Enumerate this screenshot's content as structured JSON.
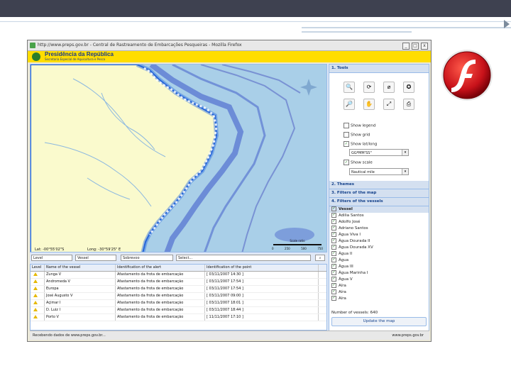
{
  "window": {
    "title": "http://www.preps.gov.br - Central de Rastreamento de Embarcações Pesqueiras - Mozilla Firefox",
    "controls": [
      "_",
      "□",
      "x"
    ]
  },
  "banner": {
    "title": "Presidência da República",
    "subtitle": "Secretaria Especial de Aquicultura e Pesca"
  },
  "map": {
    "lat_label": "Lat: -00°55'02\"S",
    "long_label": "Long: -30°59'25\" E",
    "scale_label": "Scale ratio",
    "scale_ticks": [
      "0",
      "250",
      "500",
      "750"
    ]
  },
  "tools": {
    "header": "1. Tools",
    "checks": [
      {
        "label": "Show legend",
        "checked": false
      },
      {
        "label": "Show grid",
        "checked": false
      },
      {
        "label": "Show lat/long",
        "checked": true
      },
      {
        "label": "Show scale",
        "checked": true
      }
    ],
    "latlong_select": "GGºMM'SS\"",
    "scale_select": "Nautical mile"
  },
  "sections": {
    "themes": "2. Themes",
    "map_filters": "3. Filters of the map",
    "vessel_filters": "4. Filters of the vessels"
  },
  "vessels": {
    "header": "Vessel",
    "items": [
      "Adilia Santos",
      "Adolfo José",
      "Adriano Santos",
      "Água Viva I",
      "Água Dourada II",
      "Água Dourada XV",
      "Água II",
      "Água",
      "Água III",
      "Água Marinha I",
      "Água V",
      "Aíra",
      "Aíra",
      "Aíra"
    ],
    "count_label": "Number of vessels: 640",
    "update_button": "Update the map"
  },
  "filters": {
    "level": "Level",
    "vessel": "Vessel",
    "alert": "Sobrevoo",
    "select": "Select..."
  },
  "alerts_table": {
    "columns": [
      "Level",
      "Name of the vessel",
      "Identification of the alert",
      "Identification of the point"
    ],
    "rows": [
      {
        "vessel": "Zunga V",
        "alert": "Afastamento da frota de embarcação",
        "point": "[ 03/11/2007 14:30 ]"
      },
      {
        "vessel": "Andromeda V",
        "alert": "Afastamento da frota de embarcação",
        "point": "[ 03/11/2007 17:54 ]"
      },
      {
        "vessel": "Europa",
        "alert": "Afastamento da frota de embarcação",
        "point": "[ 03/11/2007 17:54 ]"
      },
      {
        "vessel": "José Augusto V",
        "alert": "Afastamento da frota de embarcação",
        "point": "[ 03/11/2007 09:00 ]"
      },
      {
        "vessel": "Açimar I",
        "alert": "Afastamento da frota de embarcação",
        "point": "[ 03/11/2007 18:01 ]"
      },
      {
        "vessel": "D. Luiz I",
        "alert": "Afastamento da frota de embarcação",
        "point": "[ 03/11/2007 18:44 ]"
      },
      {
        "vessel": "Porto V",
        "alert": "Afastamento da frota de embarcação",
        "point": "[ 11/11/2007 17:10 ]"
      }
    ]
  },
  "statusbar": {
    "left": "Recebendo dados de www.preps.gov.br...",
    "right": "www.preps.gov.br"
  },
  "colors": {
    "ocean": "#a9cfe8",
    "land": "#fafacd",
    "banner": "#ffdd00",
    "panel_header": "#d4e0f0",
    "flash_red": "#d81e1e"
  }
}
